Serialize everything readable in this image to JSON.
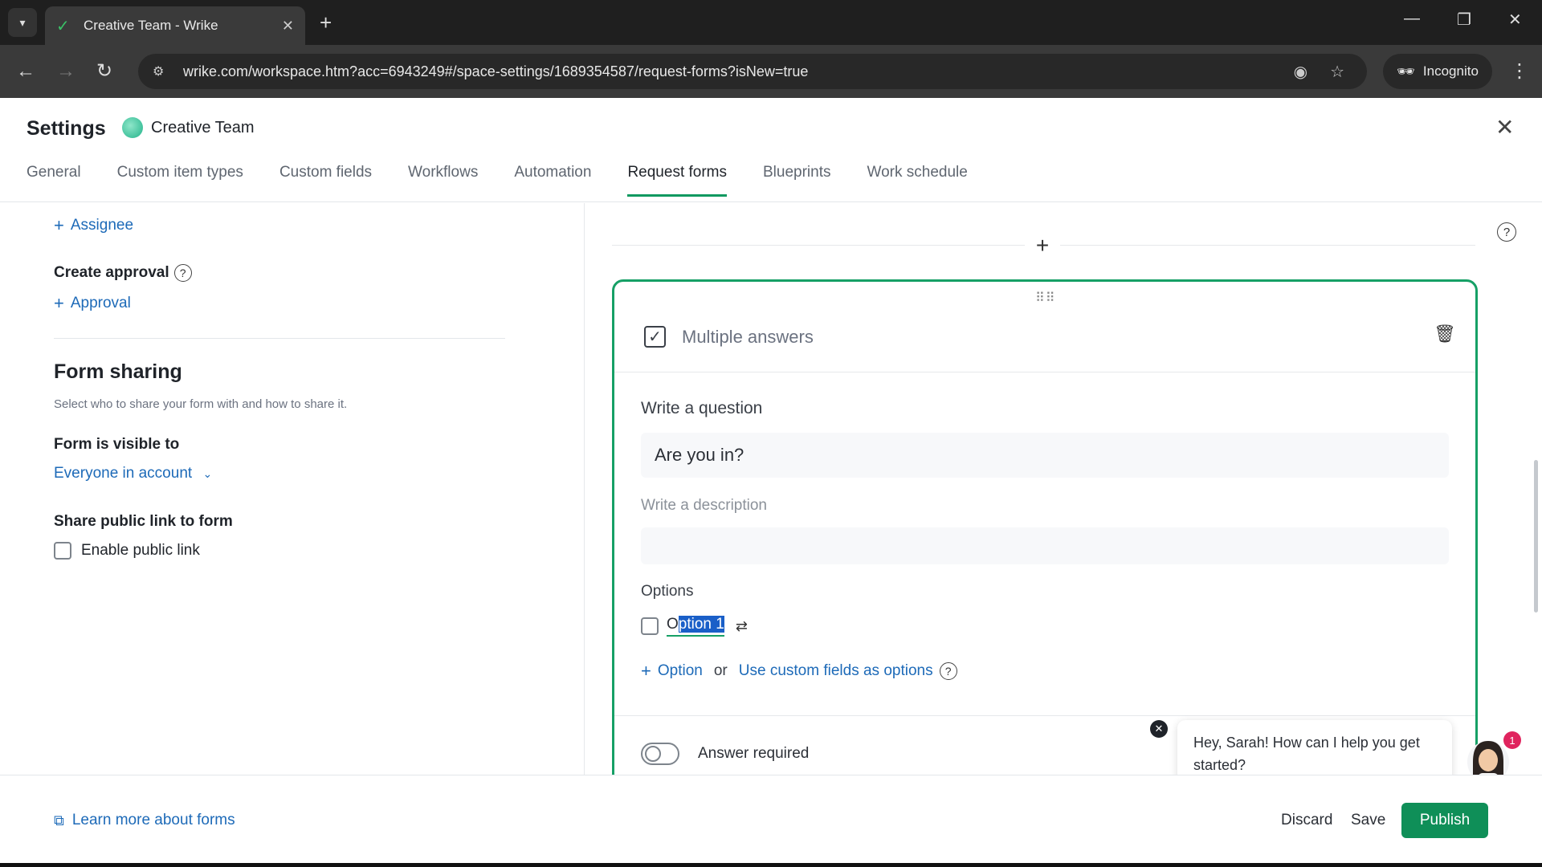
{
  "browser": {
    "tab_title": "Creative Team - Wrike",
    "url": "wrike.com/workspace.htm?acc=6943249#/space-settings/1689354587/request-forms?isNew=true",
    "incognito_label": "Incognito"
  },
  "header": {
    "title": "Settings",
    "space_name": "Creative Team",
    "tabs": [
      {
        "label": "General"
      },
      {
        "label": "Custom item types"
      },
      {
        "label": "Custom fields"
      },
      {
        "label": "Workflows"
      },
      {
        "label": "Automation"
      },
      {
        "label": "Request forms",
        "active": true
      },
      {
        "label": "Blueprints"
      },
      {
        "label": "Work schedule"
      }
    ]
  },
  "left": {
    "assignee_link": "Assignee",
    "create_approval_title": "Create approval",
    "approval_link": "Approval",
    "form_sharing_title": "Form sharing",
    "form_sharing_subtitle": "Select who to share your form with and how to share it.",
    "visible_to_title": "Form is visible to",
    "visible_to_value": "Everyone in account",
    "share_public_title": "Share public link to form",
    "enable_public_link": "Enable public link"
  },
  "question": {
    "type_label": "Multiple answers",
    "write_question_label": "Write a question",
    "question_value": "Are you in?",
    "write_description_label": "Write a description",
    "description_value": "",
    "options_label": "Options",
    "option_prefix": "O",
    "option_selected": "ption 1",
    "add_option": "Option",
    "or_text": "or",
    "custom_fields_link": "Use custom fields as options",
    "answer_required_label": "Answer required",
    "answer_required": false
  },
  "chat": {
    "message": "Hey, Sarah! How can I help you get started?",
    "badge_count": "1"
  },
  "footer": {
    "learn_more": "Learn more about forms",
    "discard": "Discard",
    "save": "Save",
    "publish": "Publish"
  },
  "colors": {
    "accent": "#0f8f58",
    "link": "#1d6ab8",
    "card_border": "#16a066"
  }
}
